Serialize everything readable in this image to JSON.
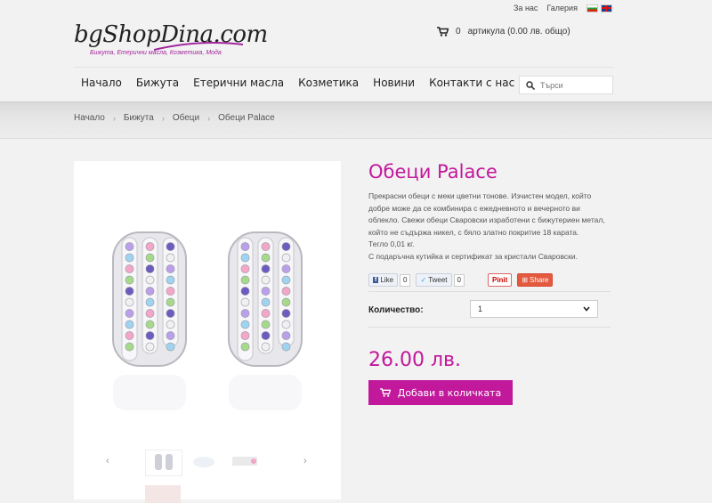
{
  "top": {
    "about": "За нас",
    "gallery": "Галерия"
  },
  "logo": {
    "title": "bgShopDina.com",
    "tagline": "Бижута, Етерични масла, Козметика, Мода"
  },
  "cart": {
    "count": "0",
    "summary": "артикула (0.00 лв. общо)"
  },
  "nav": [
    "Начало",
    "Бижута",
    "Етерични масла",
    "Козметика",
    "Новини",
    "Контакти с нас"
  ],
  "search": {
    "placeholder": "Търси"
  },
  "breadcrumb": [
    "Начало",
    "Бижута",
    "Обеци",
    "Обеци Palace"
  ],
  "product": {
    "title": "Обеци Palace",
    "description": [
      "Прекрасни обеци с меки цветни тонове. Изчистен модел, който добре може да се комбинира с ежедневното и вечерното ви облекло. Свежи обеци Сваровски изработени с бижутериен метал, който не съдържа никел, с бяло златно покритие 18 карата.",
      "Тегло 0,01 кг.",
      "С подаръчна кутийка и сертификат за кристали Сваровски."
    ],
    "quantity_label": "Количество:",
    "quantity_value": "1",
    "price": "26.00 лв.",
    "add_to_cart": "Добави в количката"
  },
  "social": {
    "like": "Like",
    "like_count": "0",
    "tweet": "Tweet",
    "tweet_count": "0",
    "pin": "Pinit",
    "share": "Share"
  },
  "colors": {
    "accent": "#c2189b",
    "crystal_colors": [
      "#b9a0e8",
      "#9fd4f0",
      "#f4a6c8",
      "#a6d98a",
      "#6e5bbf",
      "#f0f0f0"
    ]
  }
}
